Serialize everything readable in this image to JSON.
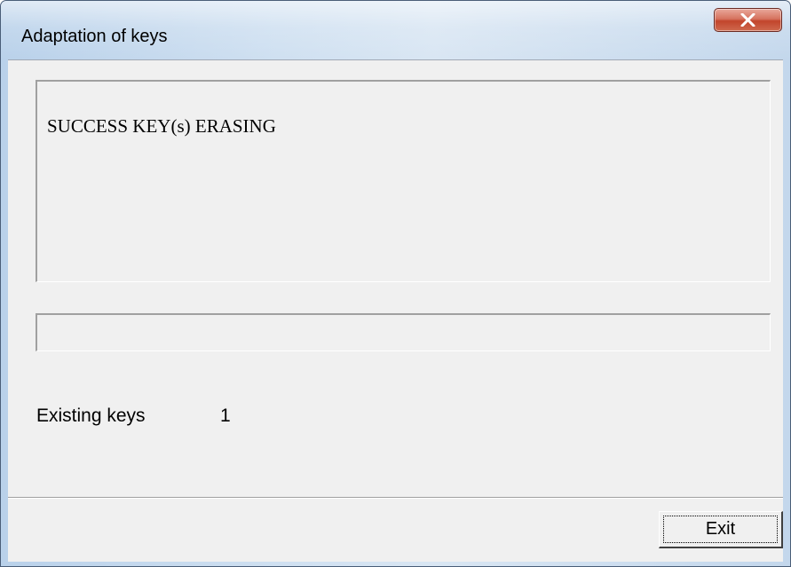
{
  "window": {
    "title": "Adaptation of keys",
    "close_icon": "close-x-icon",
    "accent_close": "#c8492f"
  },
  "main": {
    "message": "SUCCESS KEY(s) ERASING",
    "progress_percent": 0,
    "existing_keys_label": "Existing keys",
    "existing_keys_value": "1"
  },
  "footer": {
    "exit_label": "Exit"
  }
}
